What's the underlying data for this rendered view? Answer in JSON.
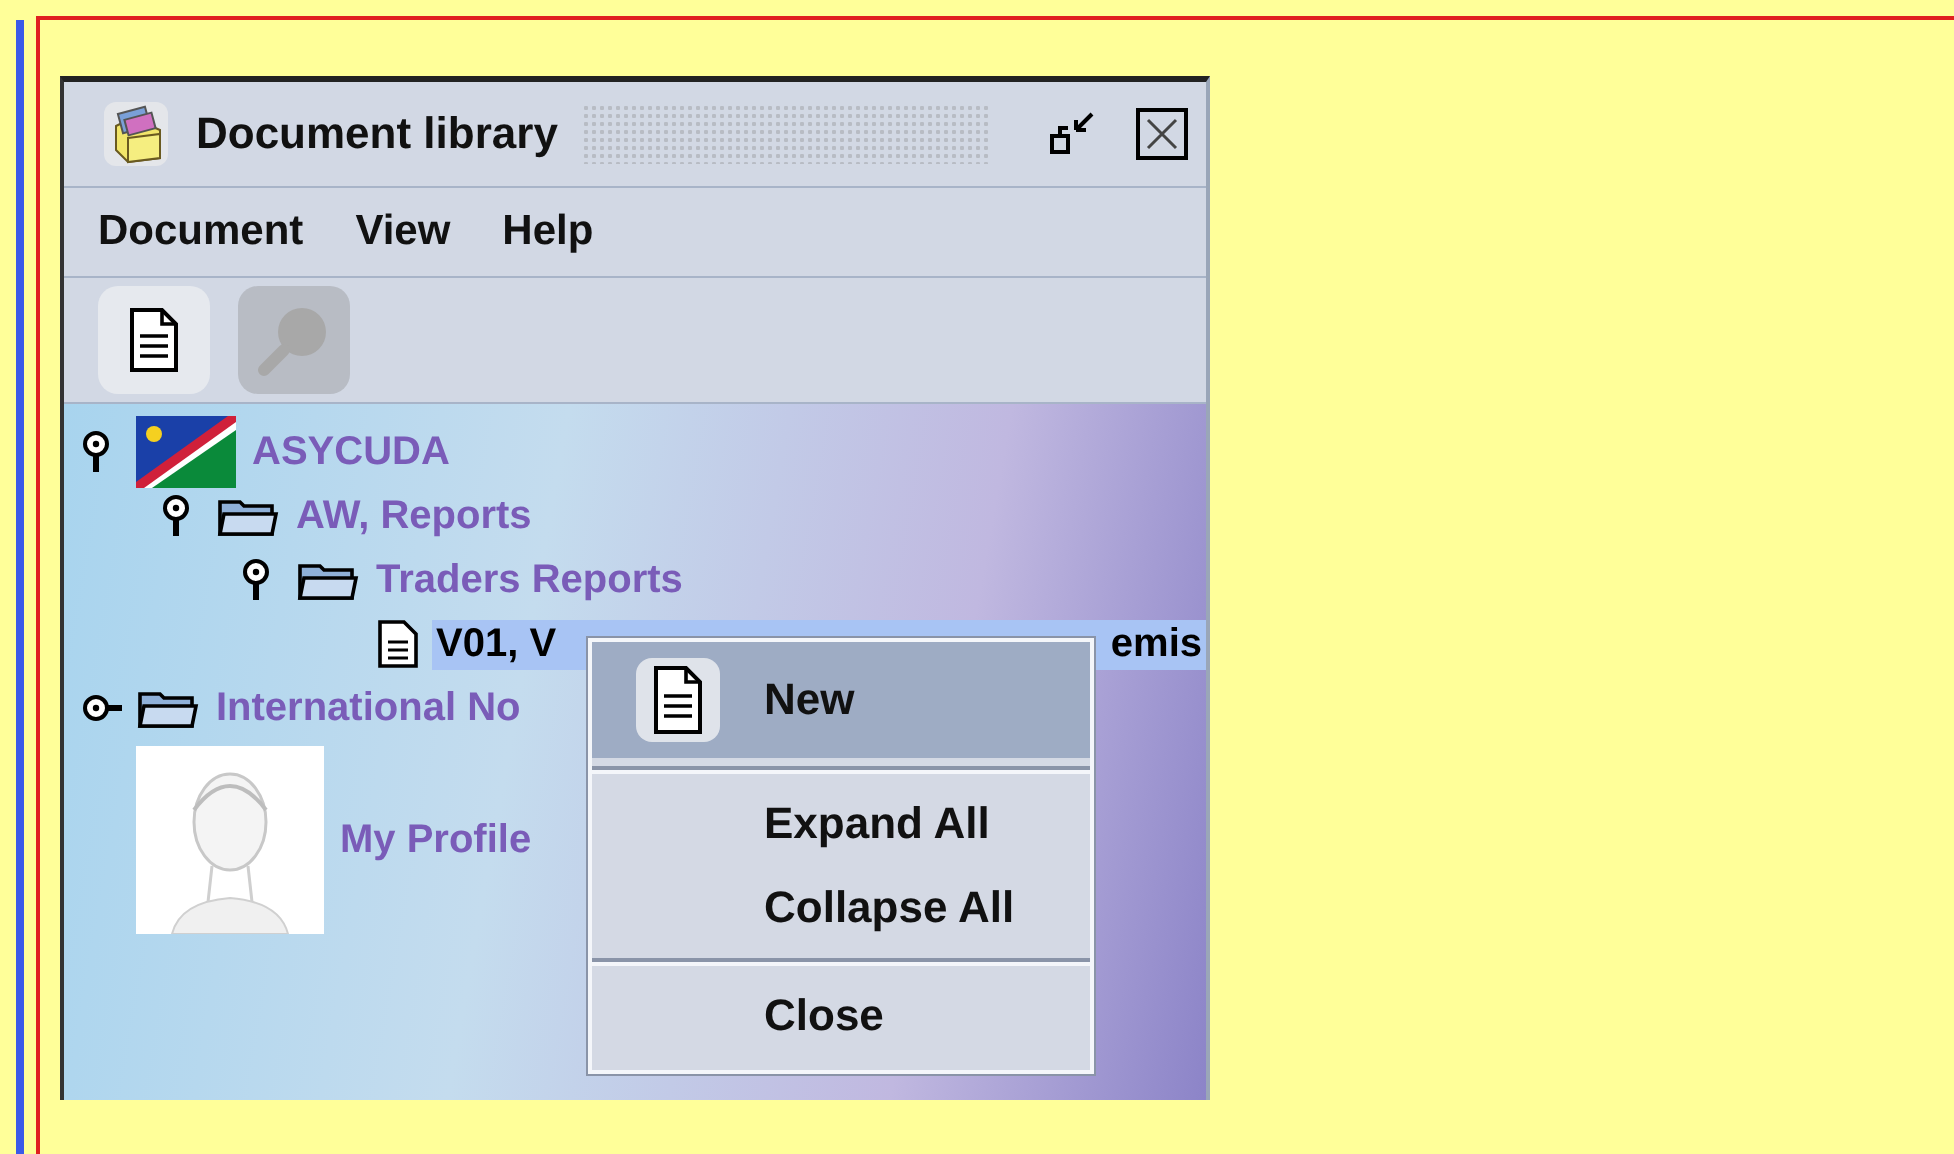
{
  "window": {
    "title": "Document library"
  },
  "menu_bar": [
    "Document",
    "View",
    "Help"
  ],
  "toolbar": [
    {
      "kind": "new",
      "disabled": false
    },
    {
      "kind": "search",
      "disabled": true
    }
  ],
  "tree": [
    {
      "kind": "flag",
      "label": "ASYCUDA",
      "expanded": true,
      "selected": false,
      "children": [
        {
          "kind": "folder",
          "label": "AW, Reports",
          "expanded": true,
          "selected": false,
          "children": [
            {
              "kind": "folder",
              "label": "Traders Reports",
              "expanded": true,
              "selected": false,
              "children": [
                {
                  "kind": "document",
                  "label": "V01, V",
                  "label_end": "emis",
                  "selected": true
                }
              ]
            }
          ]
        }
      ]
    },
    {
      "kind": "folder",
      "label": "International No",
      "expanded": false,
      "selected": false
    },
    {
      "kind": "profile",
      "label": "My Profile",
      "selected": false
    }
  ],
  "context_menu": [
    {
      "kind": "document_item",
      "label": "New",
      "selected": true
    },
    {
      "kind": "separator"
    },
    {
      "kind": "item",
      "label": "Expand All",
      "selected": false
    },
    {
      "kind": "item",
      "label": "Collapse All",
      "selected": false
    },
    {
      "kind": "separator"
    },
    {
      "kind": "item",
      "label": "Close",
      "selected": false
    }
  ]
}
